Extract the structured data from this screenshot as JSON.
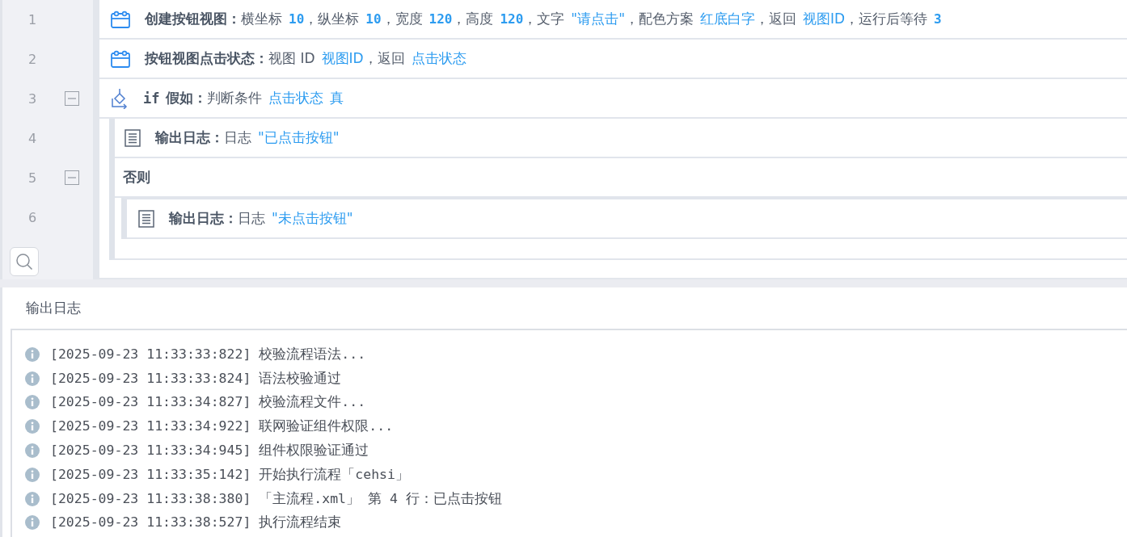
{
  "editor": {
    "gutter": [
      {
        "number": "1"
      },
      {
        "number": "2"
      },
      {
        "number": "3",
        "expanded": true
      },
      {
        "number": "4"
      },
      {
        "number": "5",
        "expanded": true
      },
      {
        "number": "6"
      }
    ],
    "blocks": [
      {
        "kind": "view",
        "title": "创建按钮视图：",
        "params": [
          {
            "kind": "text",
            "text": "横坐标"
          },
          {
            "kind": "num",
            "text": "10"
          },
          {
            "kind": "text",
            "text": "，纵坐标"
          },
          {
            "kind": "num",
            "text": "10"
          },
          {
            "kind": "text",
            "text": "，宽度"
          },
          {
            "kind": "num",
            "text": "120"
          },
          {
            "kind": "text",
            "text": "，高度"
          },
          {
            "kind": "num",
            "text": "120"
          },
          {
            "kind": "text",
            "text": "，文字"
          },
          {
            "kind": "value",
            "text": "\"请点击\""
          },
          {
            "kind": "text",
            "text": "，配色方案"
          },
          {
            "kind": "value",
            "text": "红底白字"
          },
          {
            "kind": "text",
            "text": "，返回"
          },
          {
            "kind": "value",
            "text": "视图ID"
          },
          {
            "kind": "text",
            "text": "，运行后等待"
          },
          {
            "kind": "num",
            "text": "3"
          }
        ]
      },
      {
        "kind": "view",
        "title": "按钮视图点击状态：",
        "params": [
          {
            "kind": "text",
            "text": "视图 ID"
          },
          {
            "kind": "value",
            "text": "视图ID"
          },
          {
            "kind": "text",
            "text": "，返回"
          },
          {
            "kind": "value",
            "text": "点击状态"
          }
        ]
      },
      {
        "kind": "if",
        "keyword": "if",
        "title": "假如：",
        "params": [
          {
            "kind": "text",
            "text": "判断条件"
          },
          {
            "kind": "value",
            "text": "点击状态"
          },
          {
            "kind": "value",
            "text": "真"
          }
        ],
        "children": [
          {
            "kind": "log",
            "title": "输出日志：",
            "params": [
              {
                "kind": "text",
                "text": "日志"
              },
              {
                "kind": "value",
                "text": "\"已点击按钮\""
              }
            ]
          }
        ],
        "else": {
          "label": "否则",
          "children": [
            {
              "kind": "log",
              "title": "输出日志：",
              "params": [
                {
                  "kind": "text",
                  "text": "日志"
                },
                {
                  "kind": "value",
                  "text": "\"未点击按钮\""
                }
              ]
            }
          ]
        }
      }
    ]
  },
  "log_panel": {
    "title": "输出日志",
    "entries": [
      {
        "text": "[2025-09-23 11:33:33:822] 校验流程语法..."
      },
      {
        "text": "[2025-09-23 11:33:33:824] 语法校验通过"
      },
      {
        "text": "[2025-09-23 11:33:34:827] 校验流程文件..."
      },
      {
        "text": "[2025-09-23 11:33:34:922] 联网验证组件权限..."
      },
      {
        "text": "[2025-09-23 11:33:34:945] 组件权限验证通过"
      },
      {
        "text": "[2025-09-23 11:33:35:142] 开始执行流程「cehsi」"
      },
      {
        "text": "[2025-09-23 11:33:38:380] 「主流程.xml」 第 4 行：已点击按钮"
      },
      {
        "text": "[2025-09-23 11:33:38:527] 执行流程结束"
      }
    ]
  }
}
